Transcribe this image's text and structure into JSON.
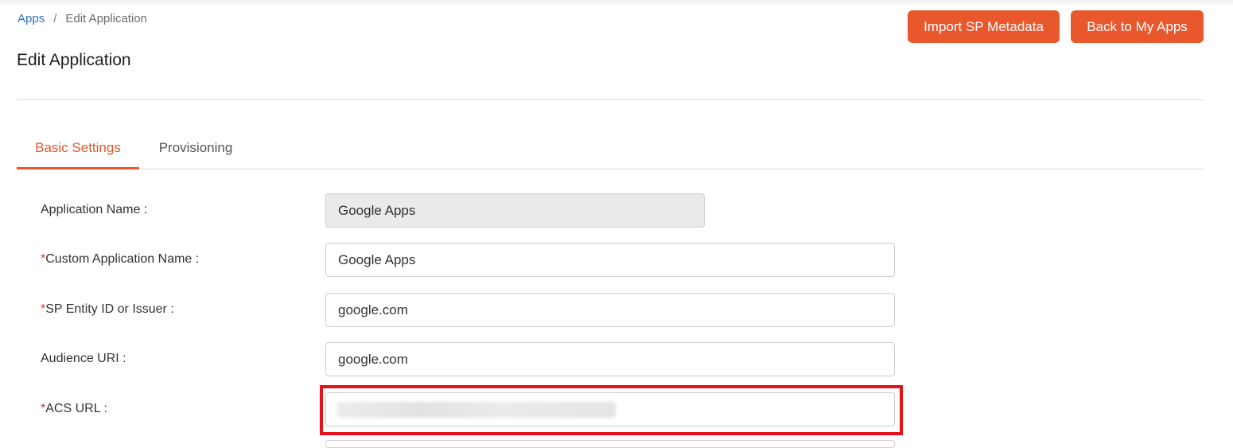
{
  "breadcrumb": {
    "root": "Apps",
    "separator": "/",
    "current": "Edit Application"
  },
  "page_title": "Edit Application",
  "header_buttons": {
    "import_label": "Import SP Metadata",
    "back_label": "Back to My Apps"
  },
  "tabs": [
    {
      "label": "Basic Settings",
      "active": true
    },
    {
      "label": "Provisioning",
      "active": false
    }
  ],
  "form": {
    "application_name": {
      "label": "Application Name :",
      "value": "Google Apps",
      "required": false,
      "disabled": true
    },
    "custom_application_name": {
      "label": "Custom Application Name :",
      "value": "Google Apps",
      "required": true
    },
    "sp_entity_id": {
      "label": "SP Entity ID or Issuer :",
      "value": "google.com",
      "required": true
    },
    "audience_uri": {
      "label": "Audience URI :",
      "value": "google.com",
      "required": false
    },
    "acs_url": {
      "label": "ACS URL :",
      "value": "",
      "required": true,
      "value_obscured": true
    }
  },
  "required_marker": "*",
  "colors": {
    "accent": "#e8582c",
    "required": "#e0382c",
    "highlight": "#e3121b",
    "link": "#2f73b4"
  }
}
